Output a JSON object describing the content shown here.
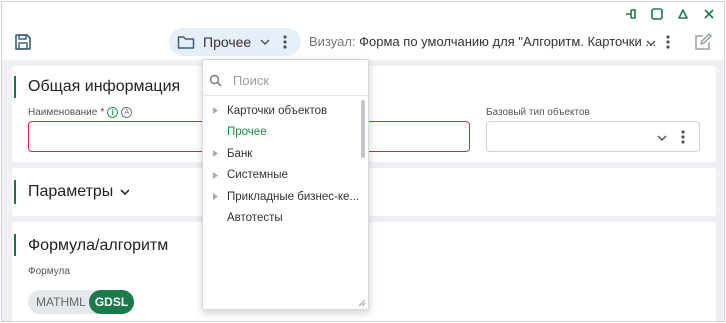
{
  "toolbar": {
    "folder_label": "Прочее",
    "visual_key": "Визуал:",
    "visual_value": "Форма по умолчанию для \"Алгоритм. Карточки ..."
  },
  "general": {
    "title": "Общая информация",
    "name_label": "Наименование",
    "required_mark": "*",
    "info_icon_text": "i",
    "auto_icon_text": "A",
    "name_value": "",
    "base_type_label": "Базовый тип объектов",
    "base_type_value": ""
  },
  "params": {
    "title": "Параметры"
  },
  "formula": {
    "title": "Формула/алгоритм",
    "label": "Формула",
    "option_a": "MATHML",
    "option_b": "GDSL",
    "selected": "GDSL"
  },
  "dropdown": {
    "search_placeholder": "Поиск",
    "items": [
      {
        "label": "Карточки объектов",
        "expandable": true,
        "selected": false
      },
      {
        "label": "Прочее",
        "expandable": false,
        "selected": true
      },
      {
        "label": "Банк",
        "expandable": true,
        "selected": false
      },
      {
        "label": "Системные",
        "expandable": true,
        "selected": false
      },
      {
        "label": "Прикладные бизнес-ке...",
        "expandable": true,
        "selected": false
      },
      {
        "label": "Автотесты",
        "expandable": false,
        "selected": false
      }
    ]
  },
  "colors": {
    "accent_green": "#1a7a4a",
    "error_red": "#e0263f",
    "pill_bg": "#e6eef9"
  }
}
